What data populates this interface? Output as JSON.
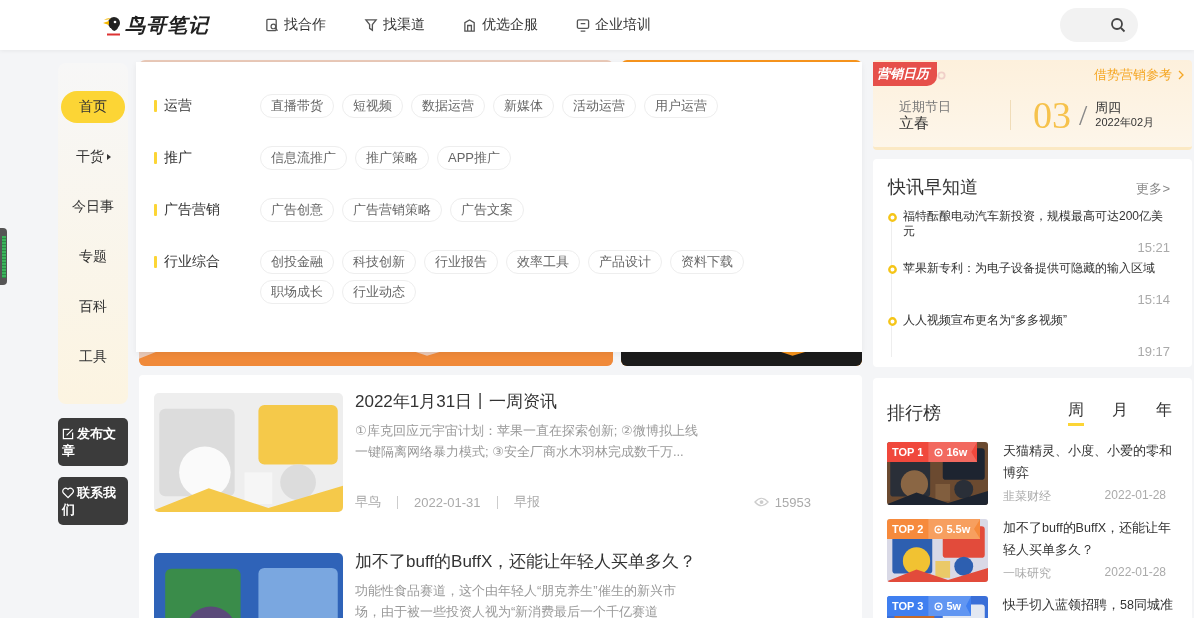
{
  "header": {
    "logo": "鸟哥笔记",
    "nav": [
      {
        "label": "找合作"
      },
      {
        "label": "找渠道"
      },
      {
        "label": "优选企服"
      },
      {
        "label": "企业培训"
      }
    ]
  },
  "side_nav": {
    "items": [
      {
        "label": "首页",
        "selected": true,
        "has_submenu": false
      },
      {
        "label": "干货",
        "selected": false,
        "has_submenu": true
      },
      {
        "label": "今日事",
        "selected": false,
        "has_submenu": false
      },
      {
        "label": "专题",
        "selected": false,
        "has_submenu": false
      },
      {
        "label": "百科",
        "selected": false,
        "has_submenu": false
      },
      {
        "label": "工具",
        "selected": false,
        "has_submenu": false
      }
    ],
    "actions": [
      {
        "label": "发布文章"
      },
      {
        "label": "联系我们"
      }
    ]
  },
  "category_menu": {
    "groups": [
      {
        "label": "运营",
        "tags": [
          "直播带货",
          "短视频",
          "数据运营",
          "新媒体",
          "活动运营",
          "用户运营"
        ]
      },
      {
        "label": "推广",
        "tags": [
          "信息流推广",
          "推广策略",
          "APP推广"
        ]
      },
      {
        "label": "广告营销",
        "tags": [
          "广告创意",
          "广告营销策略",
          "广告文案"
        ]
      },
      {
        "label": "行业综合",
        "tags": [
          "创投金融",
          "科技创新",
          "行业报告",
          "效率工具",
          "产品设计",
          "资料下载",
          "职场成长",
          "行业动态"
        ]
      }
    ]
  },
  "articles": [
    {
      "title": "2022年1月31日丨一周资讯",
      "excerpt": "①库克回应元宇宙计划：苹果一直在探索创新; ②微博拟上线一键隔离网络暴力模式; ③安全厂商水木羽林完成数千万...",
      "author": "早鸟",
      "date": "2022-01-31",
      "category": "早报",
      "views": "15953"
    },
    {
      "title": "加不了buff的BuffX，还能让年轻人买单多久？",
      "excerpt": "功能性食品赛道，这个由年轻人“朋克养生”催生的新兴市场，由于被一些投资人视为“新消费最后一个千亿赛道"
    }
  ],
  "calendar": {
    "badge": "营销日历",
    "link": "借势营销参考",
    "festival_label": "近期节日",
    "festival": "立春",
    "day": "03",
    "separator": "/",
    "weekday": "周四",
    "month": "2022年02月"
  },
  "flash_news": {
    "title": "快讯早知道",
    "more": "更多>",
    "items": [
      {
        "text": "福特酝酿电动汽车新投资，规模最高可达200亿美元",
        "time": "15:21"
      },
      {
        "text": "苹果新专利：为电子设备提供可隐藏的输入区域",
        "time": "15:14"
      },
      {
        "text": "人人视频宣布更名为“多多视频”",
        "time": "19:17"
      }
    ]
  },
  "ranking": {
    "title": "排行榜",
    "tabs": [
      {
        "label": "周",
        "selected": true
      },
      {
        "label": "月",
        "selected": false
      },
      {
        "label": "年",
        "selected": false
      }
    ],
    "items": [
      {
        "rank": "TOP 1",
        "views": "16w",
        "color": "#f0483c",
        "title": "天猫精灵、小度、小爱的零和博弈",
        "source": "韭菜财经",
        "date": "2022-01-28"
      },
      {
        "rank": "TOP 2",
        "views": "5.5w",
        "color": "#f68a3c",
        "title": "加不了buff的BuffX，还能让年轻人买单多久？",
        "source": "一味研究",
        "date": "2022-01-28"
      },
      {
        "rank": "TOP 3",
        "views": "5w",
        "color": "#3f7ff0",
        "title": "快手切入蓝领招聘，58同城准"
      }
    ]
  }
}
